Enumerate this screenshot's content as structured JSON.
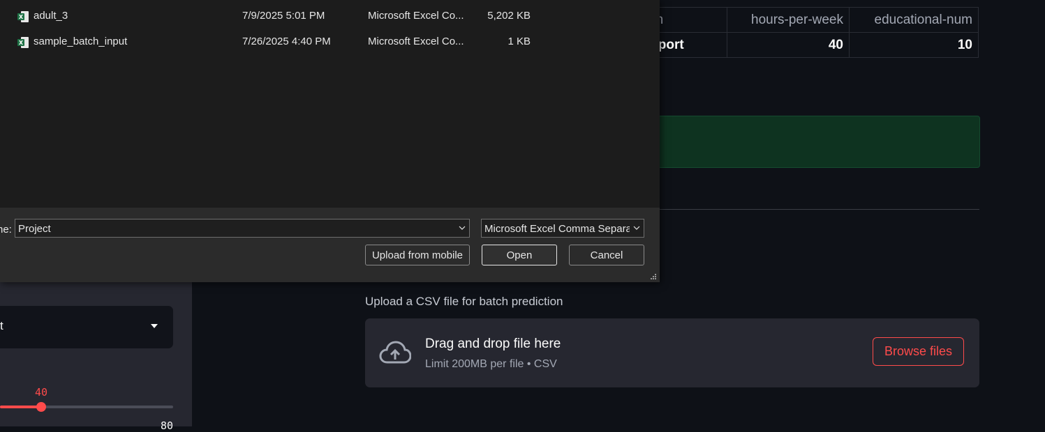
{
  "sidebar": {
    "select_value": "t",
    "slider": {
      "value_label": "40",
      "max_label": "80",
      "fraction": 0.236
    }
  },
  "table": {
    "headers": [
      "ation",
      "hours-per-week",
      "educational-num"
    ],
    "row": [
      "support",
      "40",
      "10"
    ]
  },
  "uploader": {
    "label": "Upload a CSV file for batch prediction",
    "drop_title": "Drag and drop file here",
    "drop_limit": "Limit 200MB per file • CSV",
    "browse_label": "Browse files",
    "accent": "#ff4b4b"
  },
  "dialog": {
    "files": [
      {
        "name": "adult_3",
        "date": "7/9/2025 5:01 PM",
        "type": "Microsoft Excel Co...",
        "size": "5,202 KB",
        "icon": "excel-file-icon"
      },
      {
        "name": "sample_batch_input",
        "date": "7/26/2025 4:40 PM",
        "type": "Microsoft Excel Co...",
        "size": "1 KB",
        "icon": "excel-file-icon"
      }
    ],
    "filename_label": "ne:",
    "filename_value": "Project",
    "filter_value": "Microsoft Excel Comma Separated",
    "upload_mobile_label": "Upload from mobile",
    "open_label": "Open",
    "cancel_label": "Cancel"
  }
}
